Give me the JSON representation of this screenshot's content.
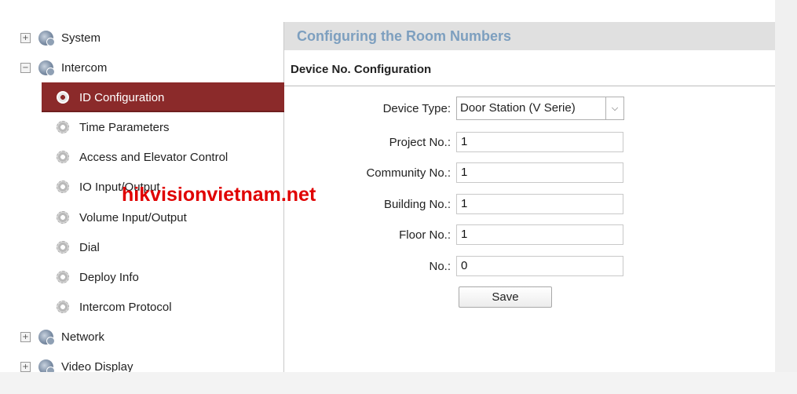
{
  "sidebar": {
    "items": [
      {
        "label": "System",
        "icon": "globe-gear-icon",
        "toggle": "+"
      },
      {
        "label": "Intercom",
        "icon": "globe-gear-icon",
        "toggle": "−"
      },
      {
        "label": "ID Configuration",
        "icon": "gear-icon"
      },
      {
        "label": "Time Parameters",
        "icon": "gear-icon"
      },
      {
        "label": "Access and Elevator Control",
        "icon": "gear-icon"
      },
      {
        "label": "IO Input/Output",
        "icon": "gear-icon"
      },
      {
        "label": "Volume Input/Output",
        "icon": "gear-icon"
      },
      {
        "label": "Dial",
        "icon": "gear-icon"
      },
      {
        "label": "Deploy Info",
        "icon": "gear-icon"
      },
      {
        "label": "Intercom Protocol",
        "icon": "gear-icon"
      },
      {
        "label": "Network",
        "icon": "globe-gear-icon",
        "toggle": "+"
      },
      {
        "label": "Video Display",
        "icon": "globe-gear-icon",
        "toggle": "+"
      }
    ],
    "selected_color": "#8b2a2a"
  },
  "watermark": "hikvisionvietnam.net",
  "main": {
    "title": "Configuring the Room Numbers",
    "section_title": "Device No. Configuration",
    "form": {
      "device_type_label": "Device Type:",
      "device_type_value": "Door Station (V Serie)",
      "project_label": "Project No.:",
      "project_value": "1",
      "community_label": "Community No.:",
      "community_value": "1",
      "building_label": "Building No.:",
      "building_value": "1",
      "floor_label": "Floor No.:",
      "floor_value": "1",
      "no_label": "No.:",
      "no_value": "0"
    },
    "save_label": "Save",
    "title_color": "#7d9fbf"
  }
}
